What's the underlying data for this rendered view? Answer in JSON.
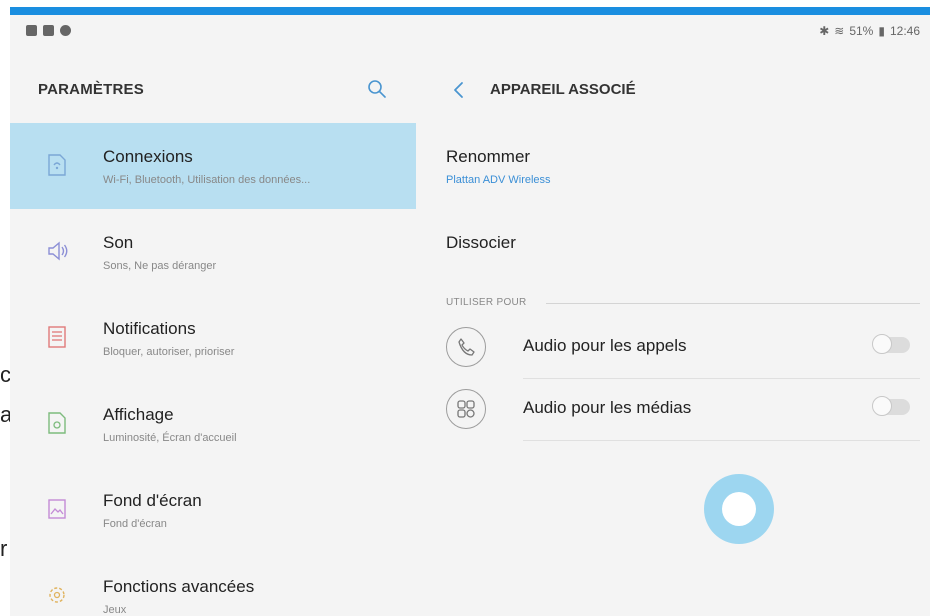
{
  "status_bar": {
    "battery": "51%",
    "time": "12:46"
  },
  "settings": {
    "title": "PARAMÈTRES",
    "items": [
      {
        "title": "Connexions",
        "subtitle": "Wi-Fi, Bluetooth, Utilisation des données...",
        "icon": "connections-icon",
        "color": "#7ba7d6",
        "active": true
      },
      {
        "title": "Son",
        "subtitle": "Sons, Ne pas déranger",
        "icon": "sound-icon",
        "color": "#8c8fd6"
      },
      {
        "title": "Notifications",
        "subtitle": "Bloquer, autoriser, prioriser",
        "icon": "notifications-icon",
        "color": "#e07a7a"
      },
      {
        "title": "Affichage",
        "subtitle": "Luminosité, Écran d'accueil",
        "icon": "display-icon",
        "color": "#7dbb7d"
      },
      {
        "title": "Fond d'écran",
        "subtitle": "Fond d'écran",
        "icon": "wallpaper-icon",
        "color": "#c38ad6"
      },
      {
        "title": "Fonctions avancées",
        "subtitle": "Jeux",
        "icon": "advanced-features-icon",
        "color": "#e0b35e"
      }
    ]
  },
  "detail": {
    "title": "APPAREIL ASSOCIÉ",
    "rename_label": "Renommer",
    "device_name": "Plattan ADV Wireless",
    "unpair_label": "Dissocier",
    "section_label": "UTILISER POUR",
    "options": [
      {
        "label": "Audio pour les appels",
        "icon": "phone-icon",
        "enabled": false
      },
      {
        "label": "Audio pour les médias",
        "icon": "media-icon",
        "enabled": false
      }
    ]
  },
  "colors": {
    "accent_bar": "#1a8ee0",
    "active_item": "#b8dff1",
    "link": "#3b8fd6",
    "spinner": "#9dd6f0"
  }
}
